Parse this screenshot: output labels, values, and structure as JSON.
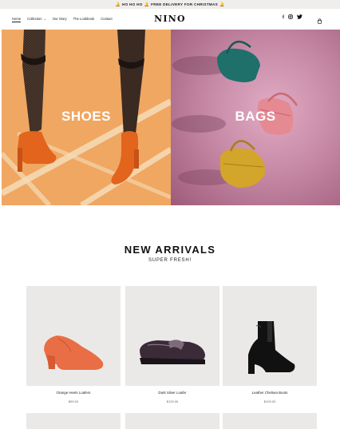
{
  "announcement": {
    "bell_icon": "bell-icon",
    "text": "HO HO HO",
    "text2": "FREE DELIVERY FOR CHRISTMAS"
  },
  "header": {
    "nav": [
      {
        "label": "Home"
      },
      {
        "label": "Collection"
      },
      {
        "label": "Our Story"
      },
      {
        "label": "The Lookbook"
      },
      {
        "label": "Contact"
      }
    ],
    "logo": "NINO",
    "social_icons": [
      "facebook-icon",
      "instagram-icon",
      "twitter-icon"
    ],
    "cart_icon": "bag-icon"
  },
  "hero": {
    "shoes_label": "SHOES",
    "bags_label": "BAGS"
  },
  "arrivals": {
    "title": "NEW ARRIVALS",
    "subtitle": "SUPER FRESH!",
    "products": [
      {
        "name": "Orange Heels Loafers",
        "price": "$99.00"
      },
      {
        "name": "Dark Silver Loafer",
        "price": "$129.00"
      },
      {
        "name": "Leather Chelsea Boots",
        "price": "$129.00"
      }
    ]
  },
  "colors": {
    "shoes_bg": "#f0a761",
    "bags_bg": "#c78aa6",
    "product_bg": "#ebe9e7"
  }
}
